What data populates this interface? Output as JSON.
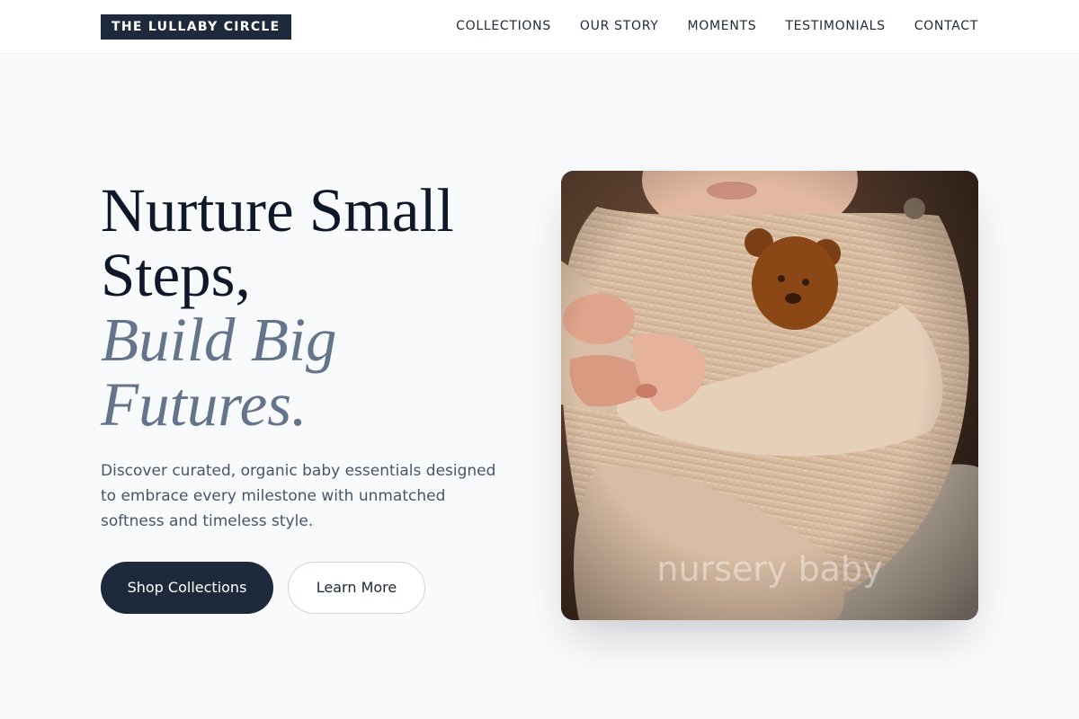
{
  "brand": {
    "name": "THE LULLABY CIRCLE"
  },
  "nav": {
    "items": [
      {
        "label": "COLLECTIONS"
      },
      {
        "label": "OUR STORY"
      },
      {
        "label": "MOMENTS"
      },
      {
        "label": "TESTIMONIALS"
      },
      {
        "label": "CONTACT"
      }
    ]
  },
  "hero": {
    "title_lines": [
      "Nurture Small",
      "Steps,"
    ],
    "accent_lines": [
      "Build Big",
      "Futures."
    ],
    "description": "Discover curated, organic baby essentials designed to embrace every milestone with unmatched softness and timeless style.",
    "primary_button": "Shop Collections",
    "secondary_button": "Learn More",
    "image_caption": "nursery baby"
  },
  "colors": {
    "brand_dark": "#1e293b",
    "accent_text": "#64748b",
    "page_background": "#f9fafb"
  }
}
